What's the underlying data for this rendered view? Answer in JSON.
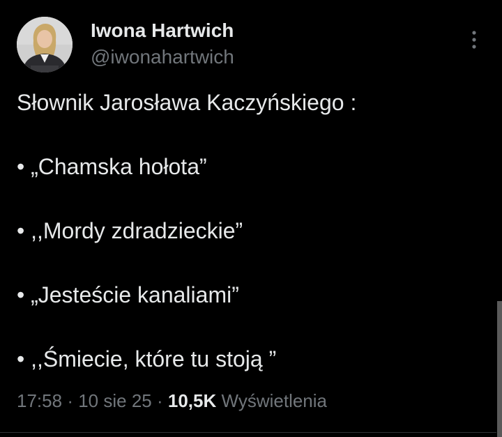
{
  "author": {
    "name": "Iwona Hartwich",
    "handle": "@iwonahartwich"
  },
  "avatar_icon": "profile-photo",
  "more_icon": "vertical-ellipsis-icon",
  "tweet": {
    "lines": [
      "Słownik Jarosława Kaczyńskiego :",
      "• „Chamska hołota”",
      "• ,,Mordy zdradzieckie”",
      "• „Jesteście kanaliami”",
      "• ,,Śmiecie, które tu stoją ”"
    ]
  },
  "meta": {
    "time": "17:58",
    "separator": "·",
    "date": "10 sie 25",
    "views_count": "10,5K",
    "views_label": "Wyświetlenia"
  },
  "colors": {
    "background": "#000000",
    "text": "#e7e9ea",
    "secondary": "#71767b"
  }
}
